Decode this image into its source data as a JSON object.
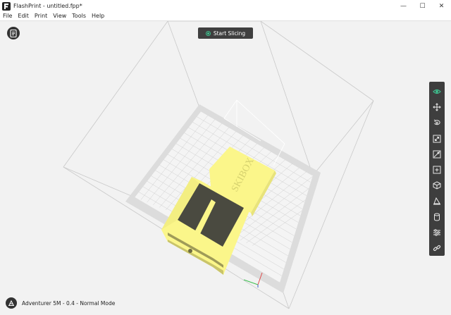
{
  "window": {
    "title": "FlashPrint - untitled.fpp*",
    "minimize": "—",
    "maximize": "☐",
    "close": "✕"
  },
  "menu": [
    "File",
    "Edit",
    "Print",
    "View",
    "Tools",
    "Help"
  ],
  "slice_button": {
    "label": "Start Slicing"
  },
  "model": {
    "engraving": "SKIBOX",
    "color": "#fbf68a"
  },
  "toolbar": {
    "items": [
      "view",
      "move",
      "rotate",
      "scale",
      "cut",
      "supports",
      "extruder",
      "lay-flat",
      "filament",
      "settings",
      "link"
    ],
    "accent": "#3ec28f"
  },
  "status": {
    "printer": "Adventurer 5M - 0.4 - Normal Mode"
  },
  "colors": {
    "background": "#f2f2f2",
    "toolbar": "#3e3e3e",
    "plate": "#dcdcdc"
  }
}
